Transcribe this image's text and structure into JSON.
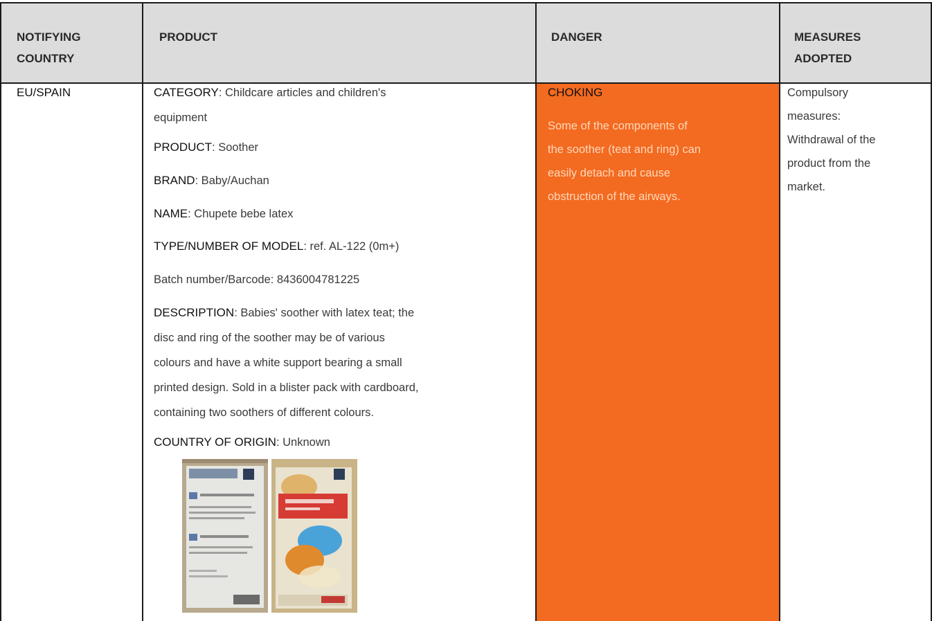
{
  "header": {
    "col1": [
      "NOTIFYING",
      "COUNTRY"
    ],
    "col2": "PRODUCT",
    "col3": "DANGER",
    "col4": [
      "MEASURES",
      "ADOPTED"
    ]
  },
  "row": {
    "country": "EU/SPAIN",
    "product": {
      "category_key": "CATEGORY",
      "category_val_1": ": Childcare articles and children's",
      "category_val_2": "equipment",
      "product_key": "PRODUCT",
      "product_val": ": Soother",
      "brand_key": "BRAND",
      "brand_val": ": Baby/Auchan",
      "name_key": "NAME",
      "name_val": ": Chupete bebe latex",
      "model_key": "TYPE/NUMBER OF MODEL",
      "model_val": ": ref. AL-122 (0m+)",
      "batch": "Batch number/Barcode: 8436004781225",
      "desc_key": "DESCRIPTION",
      "desc_val_1": ": Babies' soother with latex teat; the",
      "desc_2": "disc and ring of the soother may be of various",
      "desc_3": "colours and have a white support bearing a small",
      "desc_4": "printed design. Sold in a blister pack with cardboard,",
      "desc_5": "containing two soothers of different colours.",
      "origin_key": "COUNTRY OF ORIGIN",
      "origin_val": ": Unknown"
    },
    "danger": {
      "title": "CHOKING",
      "lines": [
        "Some of the components of",
        "the soother (teat and ring) can",
        "easily detach and cause",
        "obstruction of the airways."
      ],
      "color": "#f36a21"
    },
    "measures": {
      "lines": [
        "Compulsory",
        "measures:",
        "Withdrawal of the",
        "product from the",
        "market."
      ]
    }
  }
}
